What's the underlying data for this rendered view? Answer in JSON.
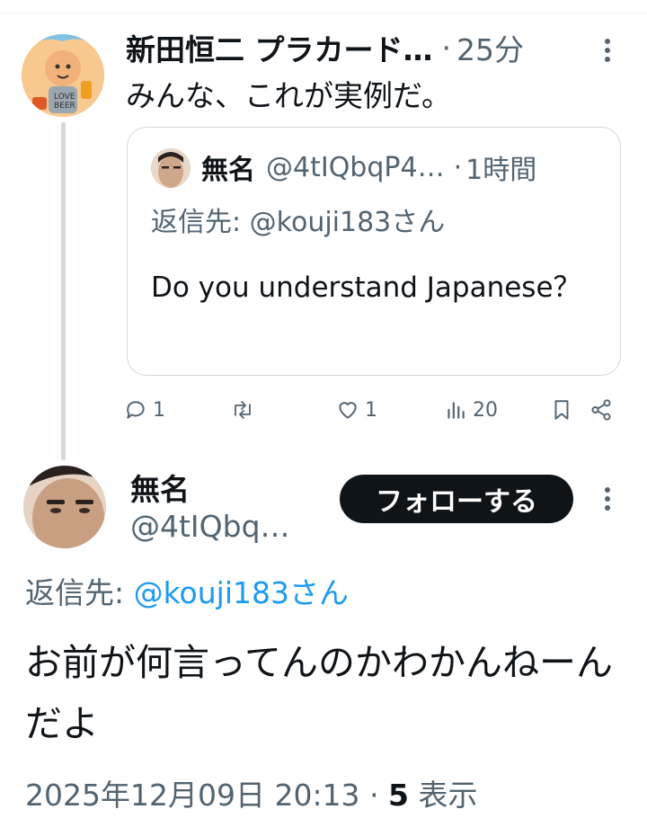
{
  "tweet1": {
    "name": "新田恒二 プラカード…",
    "time": "25分",
    "text": "みんな、これが実例だ。",
    "quote": {
      "name": "無名",
      "handle": "@4tIQbqP4…",
      "time": "1時間",
      "reply_prefix": "返信先:",
      "reply_mention": "@kouji183さん",
      "text": "Do you understand Japanese？"
    },
    "actions": {
      "replies": "1",
      "retweets": "",
      "likes": "1",
      "views": "20"
    }
  },
  "tweet2": {
    "name": "無名",
    "handle": "@4tIQbq…",
    "follow_label": "フォローする",
    "reply_prefix": "返信先:",
    "reply_mention": "@kouji183さん",
    "text": "お前が何言ってんのかわかんねーんだよ",
    "timestamp": "2025年12月09日 20:13",
    "views_count": "5",
    "views_label": "表示"
  },
  "colors": {
    "text": "#0f1419",
    "secondary": "#536471",
    "link": "#1d9bf0",
    "border": "#cfd9de",
    "follow_bg": "#0f1419"
  },
  "icons": [
    "more-icon",
    "reply-icon",
    "retweet-icon",
    "like-icon",
    "views-icon",
    "bookmark-icon",
    "share-icon"
  ]
}
